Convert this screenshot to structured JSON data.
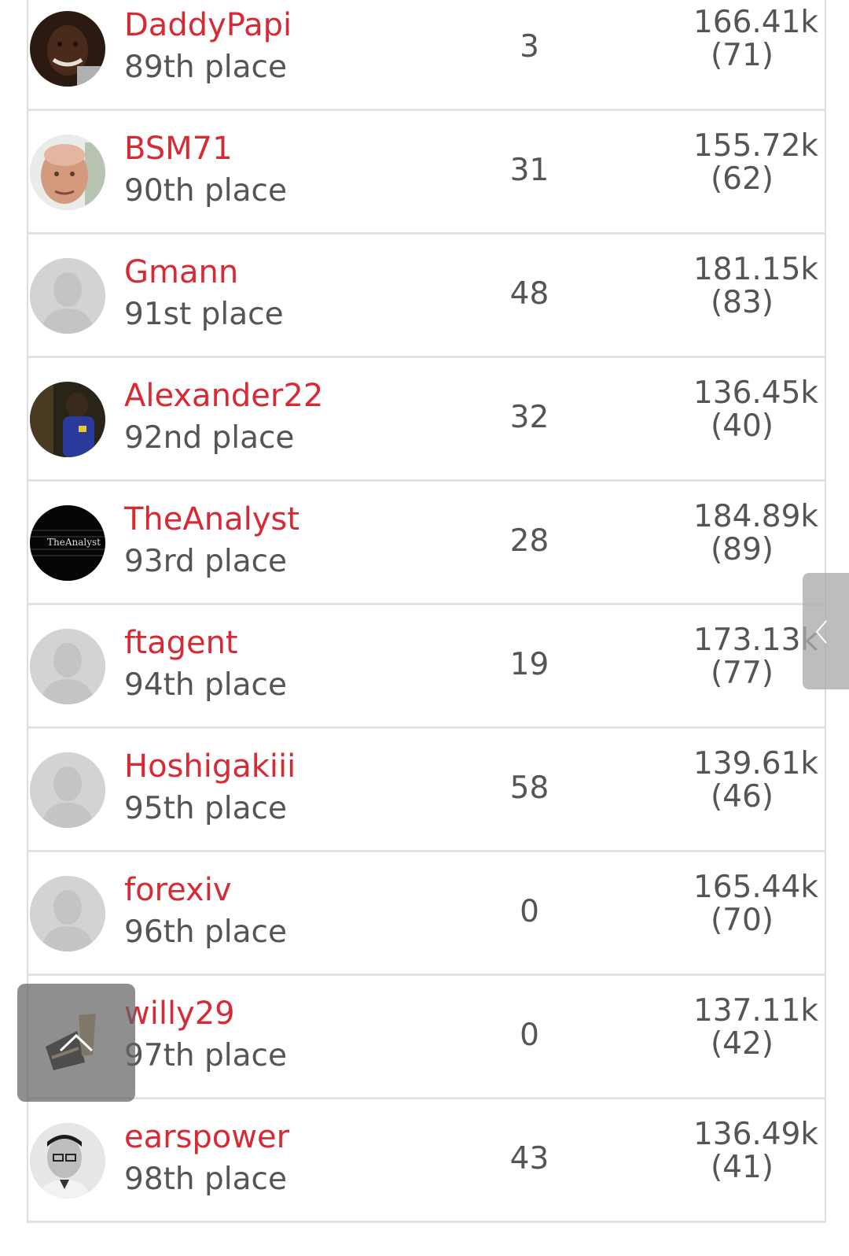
{
  "leaderboard": {
    "rows": [
      {
        "name": "DaddyPapi",
        "place": "89th place",
        "count": "3",
        "amount": "166.41k",
        "rank": "(71)",
        "avatar": "photo-man-smiling"
      },
      {
        "name": "BSM71",
        "place": "90th place",
        "count": "31",
        "amount": "155.72k",
        "rank": "(62)",
        "avatar": "photo-bald-man"
      },
      {
        "name": "Gmann",
        "place": "91st place",
        "count": "48",
        "amount": "181.15k",
        "rank": "(83)",
        "avatar": "default-user"
      },
      {
        "name": "Alexander22",
        "place": "92nd place",
        "count": "32",
        "amount": "136.45k",
        "rank": "(40)",
        "avatar": "photo-man-blue-shirt"
      },
      {
        "name": "TheAnalyst",
        "place": "93rd place",
        "count": "28",
        "amount": "184.89k",
        "rank": "(89)",
        "avatar": "logo-theanalyst",
        "avatar_text": "TheAnalyst"
      },
      {
        "name": "ftagent",
        "place": "94th place",
        "count": "19",
        "amount": "173.13k",
        "rank": "(77)",
        "avatar": "default-user"
      },
      {
        "name": "Hoshigakiii",
        "place": "95th place",
        "count": "58",
        "amount": "139.61k",
        "rank": "(46)",
        "avatar": "default-user"
      },
      {
        "name": "forexiv",
        "place": "96th place",
        "count": "0",
        "amount": "165.44k",
        "rank": "(70)",
        "avatar": "default-user"
      },
      {
        "name": "willy29",
        "place": "97th place",
        "count": "0",
        "amount": "137.11k",
        "rank": "(42)",
        "avatar": "photo-chair"
      },
      {
        "name": "earspower",
        "place": "98th place",
        "count": "43",
        "amount": "136.49k",
        "rank": "(41)",
        "avatar": "photo-man-glasses-bw"
      }
    ]
  },
  "controls": {
    "side_tab_icon": "chevron-left-icon",
    "scroll_top_icon": "chevron-up-icon"
  },
  "colors": {
    "name": "#d62a34",
    "text": "#555555",
    "divider": "#e2e2e2"
  }
}
